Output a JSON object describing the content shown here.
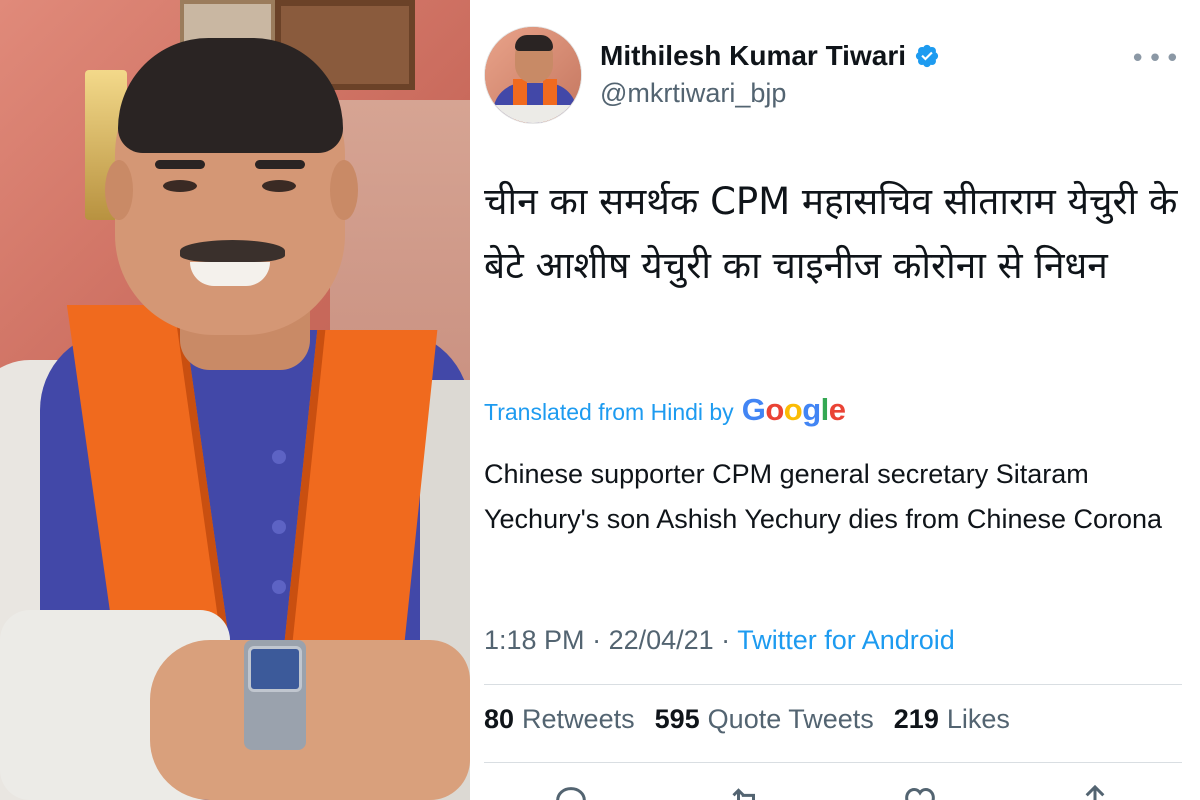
{
  "tweet": {
    "display_name": "Mithilesh Kumar Tiwari",
    "handle": "@mkrtiwari_bjp",
    "more_icon": "more-dots-icon",
    "verified_icon": "verified-badge-icon",
    "hindi_text": "चीन का समर्थक CPM महासचिव सीताराम येचुरी के बेटे आशीष येचुरी का चाइनीज कोरोना से निधन",
    "translated_label": "Translated from Hindi by",
    "google_logo": [
      "G",
      "o",
      "o",
      "g",
      "l",
      "e"
    ],
    "english_text": "Chinese supporter CPM general secretary Sitaram Yechury's son Ashish Yechury dies from Chinese Corona",
    "time": "1:18 PM",
    "date": "22/04/21",
    "separator": " · ",
    "source": "Twitter for Android",
    "stats": {
      "retweets": {
        "num": "80",
        "label": "Retweets"
      },
      "quotes": {
        "num": "595",
        "label": "Quote Tweets"
      },
      "likes": {
        "num": "219",
        "label": "Likes"
      }
    },
    "actions": [
      "reply-icon",
      "retweet-icon",
      "like-icon",
      "share-icon"
    ]
  },
  "colors": {
    "link": "#1d9bf0",
    "muted": "#536471",
    "text": "#0f1419",
    "saffron": "#f06a1e",
    "vest_blue": "#4248a8"
  }
}
